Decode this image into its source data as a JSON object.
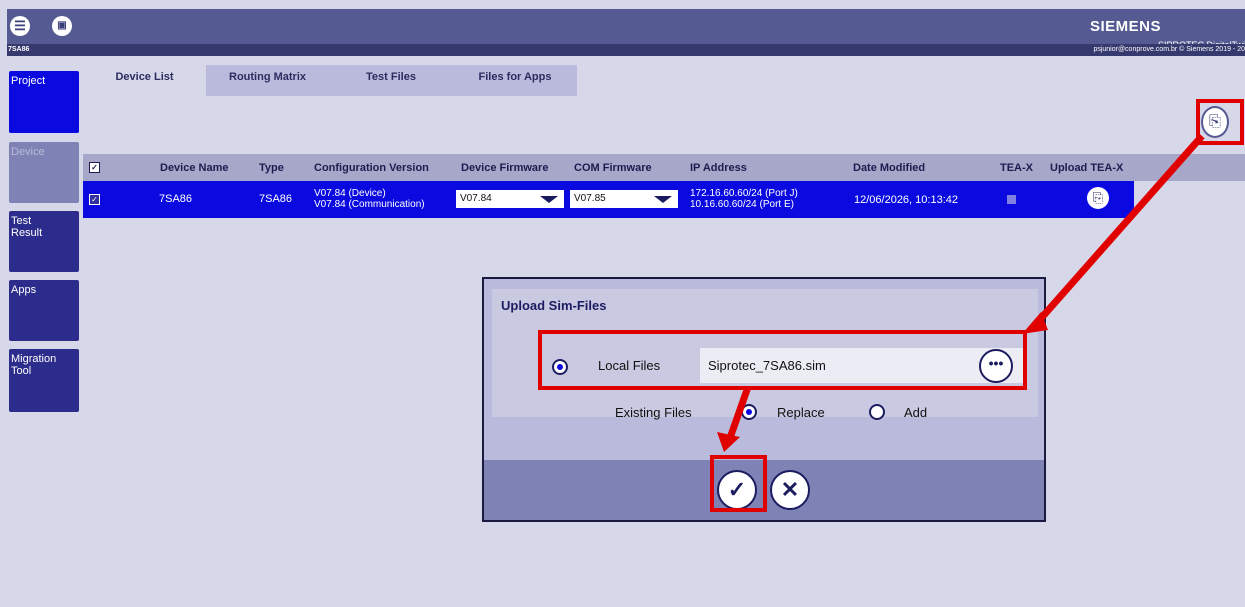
{
  "header": {
    "brand": "SIEMENS",
    "product": "SIPROTEC DigitalTwi",
    "device_name": "7SA86",
    "user": "psjunior@conprove.com.br  © Siemens 2019 - 20",
    "menu_icon": "menu-icon",
    "device_icon": "devices-icon"
  },
  "sidebar": {
    "items": [
      {
        "label": "Project",
        "state": "active"
      },
      {
        "label": "Device",
        "state": "disabled"
      },
      {
        "label": "Test Result",
        "state": "normal"
      },
      {
        "label": "Apps",
        "state": "normal"
      },
      {
        "label": "Migration Tool",
        "state": "normal"
      }
    ]
  },
  "tabs": [
    {
      "label": "Device List",
      "active": true
    },
    {
      "label": "Routing Matrix",
      "active": false
    },
    {
      "label": "Test Files",
      "active": false
    },
    {
      "label": "Files for Apps",
      "active": false
    }
  ],
  "table": {
    "columns": [
      "Device Name",
      "Type",
      "Configuration Version",
      "Device Firmware",
      "COM Firmware",
      "IP Address",
      "Date Modified",
      "TEA-X",
      "Upload TEA-X"
    ],
    "rows": [
      {
        "device_name": "7SA86",
        "type": "7SA86",
        "config_version": [
          "V07.84 (Device)",
          "V07.84 (Communication)"
        ],
        "device_firmware": "V07.84",
        "com_firmware": "V07.85",
        "ip_address": [
          "172.16.60.60/24 (Port J)",
          "10.16.60.60/24 (Port E)"
        ],
        "date_modified": "12/06/2026, 10:13:42"
      }
    ]
  },
  "dialog": {
    "title": "Upload Sim-Files",
    "local_files_label": "Local Files",
    "file_name": "Siprotec_7SA86.sim",
    "browse_label": "•••",
    "existing_files_label": "Existing Files",
    "replace_label": "Replace",
    "add_label": "Add",
    "confirm_icon": "✓",
    "cancel_icon": "✕"
  },
  "colors": {
    "accent": "#0a0ae0",
    "highlight": "#e00000",
    "header": "#555b92"
  }
}
